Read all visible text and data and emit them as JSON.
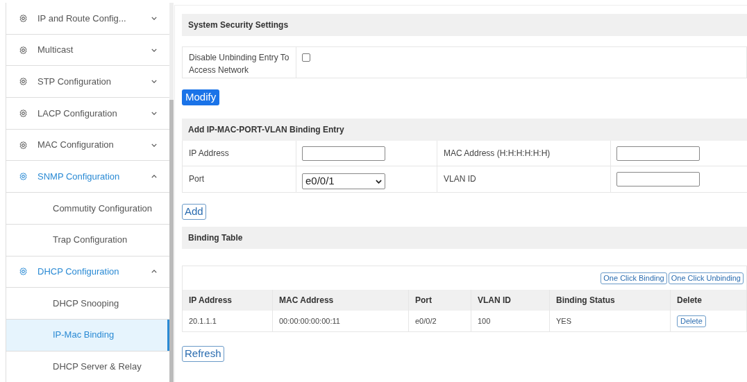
{
  "sidebar": {
    "items": [
      {
        "label": "IP and Route Config...",
        "expanded": false
      },
      {
        "label": "Multicast",
        "expanded": false
      },
      {
        "label": "STP Configuration",
        "expanded": false
      },
      {
        "label": "LACP Configuration",
        "expanded": false
      },
      {
        "label": "MAC Configuration",
        "expanded": false
      },
      {
        "label": "SNMP Configuration",
        "expanded": true,
        "children": [
          {
            "label": "Commutity Configuration",
            "selected": false
          },
          {
            "label": "Trap Configuration",
            "selected": false
          }
        ]
      },
      {
        "label": "DHCP Configuration",
        "expanded": true,
        "children": [
          {
            "label": "DHCP Snooping",
            "selected": false
          },
          {
            "label": "IP-Mac Binding",
            "selected": true
          },
          {
            "label": "DHCP Server & Relay",
            "selected": false
          }
        ]
      }
    ]
  },
  "security": {
    "title": "System Security Settings",
    "label": "Disable Unbinding Entry To Access Network",
    "checked": false,
    "button": "Modify"
  },
  "add_entry": {
    "title": "Add IP-MAC-PORT-VLAN Binding Entry",
    "fields": [
      {
        "label": "IP Address",
        "kind": "input"
      },
      {
        "label": "MAC Address (H:H:H:H:H:H)",
        "kind": "input"
      },
      {
        "label": "Port",
        "kind": "select",
        "value": "e0/0/1"
      },
      {
        "label": "VLAN ID",
        "kind": "input"
      }
    ],
    "button": "Add"
  },
  "binding_table": {
    "title": "Binding Table",
    "actions": [
      "One Click Binding",
      "One Click Unbinding"
    ],
    "columns": [
      "IP Address",
      "MAC Address",
      "Port",
      "VLAN ID",
      "Binding Status",
      "Delete"
    ],
    "rows": [
      {
        "cells": [
          "20.1.1.1",
          "00:00:00:00:00:11",
          "e0/0/2",
          "100",
          "YES"
        ],
        "action": "Delete"
      }
    ],
    "button": "Refresh"
  }
}
